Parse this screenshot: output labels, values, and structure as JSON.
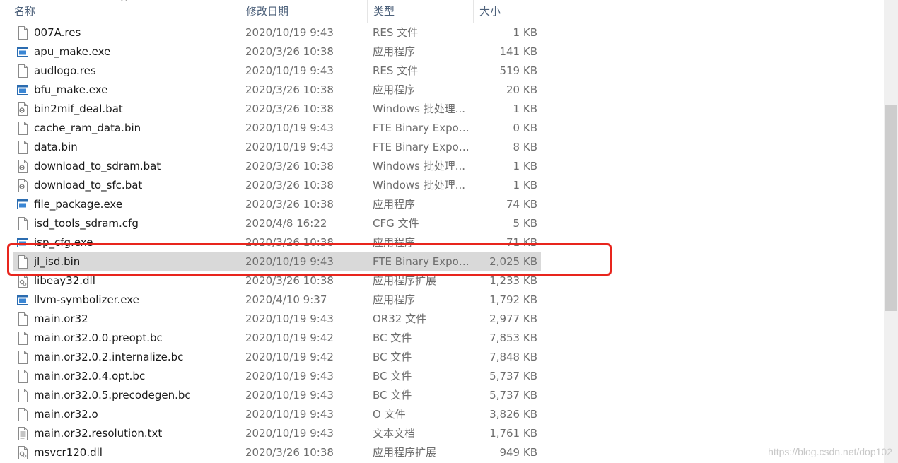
{
  "columns": {
    "name": "名称",
    "date": "修改日期",
    "type": "类型",
    "size": "大小"
  },
  "files": [
    {
      "name": "007A.res",
      "date": "2020/10/19 9:43",
      "type": "RES 文件",
      "size": "1 KB",
      "icon": "blank"
    },
    {
      "name": "apu_make.exe",
      "date": "2020/3/26 10:38",
      "type": "应用程序",
      "size": "141 KB",
      "icon": "exe"
    },
    {
      "name": "audlogo.res",
      "date": "2020/10/19 9:43",
      "type": "RES 文件",
      "size": "519 KB",
      "icon": "blank"
    },
    {
      "name": "bfu_make.exe",
      "date": "2020/3/26 10:38",
      "type": "应用程序",
      "size": "20 KB",
      "icon": "exe"
    },
    {
      "name": "bin2mif_deal.bat",
      "date": "2020/3/26 10:38",
      "type": "Windows 批处理...",
      "size": "1 KB",
      "icon": "bat"
    },
    {
      "name": "cache_ram_data.bin",
      "date": "2020/10/19 9:43",
      "type": "FTE Binary Expor...",
      "size": "0 KB",
      "icon": "blank"
    },
    {
      "name": "data.bin",
      "date": "2020/10/19 9:43",
      "type": "FTE Binary Expor...",
      "size": "8 KB",
      "icon": "blank"
    },
    {
      "name": "download_to_sdram.bat",
      "date": "2020/3/26 10:38",
      "type": "Windows 批处理...",
      "size": "1 KB",
      "icon": "bat"
    },
    {
      "name": "download_to_sfc.bat",
      "date": "2020/3/26 10:38",
      "type": "Windows 批处理...",
      "size": "1 KB",
      "icon": "bat"
    },
    {
      "name": "file_package.exe",
      "date": "2020/3/26 10:38",
      "type": "应用程序",
      "size": "74 KB",
      "icon": "exe"
    },
    {
      "name": "isd_tools_sdram.cfg",
      "date": "2020/4/8 16:22",
      "type": "CFG 文件",
      "size": "5 KB",
      "icon": "blank"
    },
    {
      "name": "isp_cfg.exe",
      "date": "2020/3/26 10:38",
      "type": "应用程序",
      "size": "71 KB",
      "icon": "exe"
    },
    {
      "name": "jl_isd.bin",
      "date": "2020/10/19 9:43",
      "type": "FTE Binary Expor...",
      "size": "2,025 KB",
      "icon": "blank",
      "selected": true
    },
    {
      "name": "libeay32.dll",
      "date": "2020/3/26 10:38",
      "type": "应用程序扩展",
      "size": "1,233 KB",
      "icon": "dll"
    },
    {
      "name": "llvm-symbolizer.exe",
      "date": "2020/4/10 9:37",
      "type": "应用程序",
      "size": "1,792 KB",
      "icon": "exe"
    },
    {
      "name": "main.or32",
      "date": "2020/10/19 9:43",
      "type": "OR32 文件",
      "size": "2,977 KB",
      "icon": "blank"
    },
    {
      "name": "main.or32.0.0.preopt.bc",
      "date": "2020/10/19 9:42",
      "type": "BC 文件",
      "size": "7,853 KB",
      "icon": "blank"
    },
    {
      "name": "main.or32.0.2.internalize.bc",
      "date": "2020/10/19 9:42",
      "type": "BC 文件",
      "size": "7,848 KB",
      "icon": "blank"
    },
    {
      "name": "main.or32.0.4.opt.bc",
      "date": "2020/10/19 9:43",
      "type": "BC 文件",
      "size": "5,737 KB",
      "icon": "blank"
    },
    {
      "name": "main.or32.0.5.precodegen.bc",
      "date": "2020/10/19 9:43",
      "type": "BC 文件",
      "size": "5,737 KB",
      "icon": "blank"
    },
    {
      "name": "main.or32.o",
      "date": "2020/10/19 9:43",
      "type": "O 文件",
      "size": "3,826 KB",
      "icon": "blank"
    },
    {
      "name": "main.or32.resolution.txt",
      "date": "2020/10/19 9:43",
      "type": "文本文档",
      "size": "1,761 KB",
      "icon": "txt"
    },
    {
      "name": "msvcr120.dll",
      "date": "2020/3/26 10:38",
      "type": "应用程序扩展",
      "size": "949 KB",
      "icon": "dll"
    }
  ],
  "watermark": "https://blog.csdn.net/dop102",
  "colors": {
    "highlight_border": "#e8251d",
    "selected_row": "#d9d9d9",
    "header_text": "#4c607a"
  }
}
